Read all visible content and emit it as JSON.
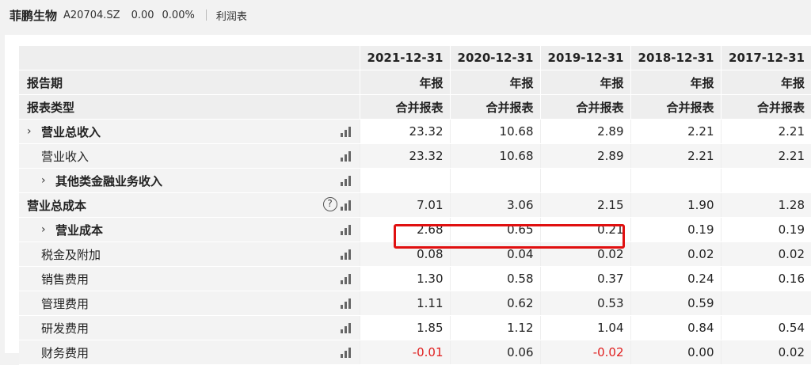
{
  "header": {
    "stock_name": "菲鹏生物",
    "stock_code": "A20704.SZ",
    "price": "0.00",
    "change_pct": "0.00%",
    "tab": "利润表"
  },
  "table": {
    "header_rows": [
      {
        "label": "",
        "values": [
          "2021-12-31",
          "2020-12-31",
          "2019-12-31",
          "2018-12-31",
          "2017-12-31"
        ]
      },
      {
        "label": "报告期",
        "values": [
          "年报",
          "年报",
          "年报",
          "年报",
          "年报"
        ]
      },
      {
        "label": "报表类型",
        "values": [
          "合并报表",
          "合并报表",
          "合并报表",
          "合并报表",
          "合并报表"
        ]
      }
    ],
    "rows": [
      {
        "label": "营业总收入",
        "values": [
          "23.32",
          "10.68",
          "2.89",
          "2.21",
          "2.21"
        ]
      },
      {
        "label": "营业收入",
        "values": [
          "23.32",
          "10.68",
          "2.89",
          "2.21",
          "2.21"
        ]
      },
      {
        "label": "其他类金融业务收入",
        "values": [
          "",
          "",
          "",
          "",
          ""
        ]
      },
      {
        "label": "营业总成本",
        "values": [
          "7.01",
          "3.06",
          "2.15",
          "1.90",
          "1.28"
        ]
      },
      {
        "label": "营业成本",
        "values": [
          "2.68",
          "0.65",
          "0.21",
          "0.19",
          "0.19"
        ]
      },
      {
        "label": "税金及附加",
        "values": [
          "0.08",
          "0.04",
          "0.02",
          "0.02",
          "0.02"
        ]
      },
      {
        "label": "销售费用",
        "values": [
          "1.30",
          "0.58",
          "0.37",
          "0.24",
          "0.16"
        ]
      },
      {
        "label": "管理费用",
        "values": [
          "1.11",
          "0.62",
          "0.53",
          "0.59",
          ""
        ]
      },
      {
        "label": "研发费用",
        "values": [
          "1.85",
          "1.12",
          "1.04",
          "0.84",
          "0.54"
        ]
      },
      {
        "label": "财务费用",
        "values": [
          "-0.01",
          "0.06",
          "-0.02",
          "0.00",
          "0.02"
        ]
      }
    ],
    "help_symbol": "?",
    "expand_symbol": "›"
  },
  "colors": {
    "negative": "#e02020",
    "highlight_box": "#e01010"
  },
  "icons": [
    "chevron-right-icon",
    "bar-chart-icon",
    "help-icon"
  ]
}
